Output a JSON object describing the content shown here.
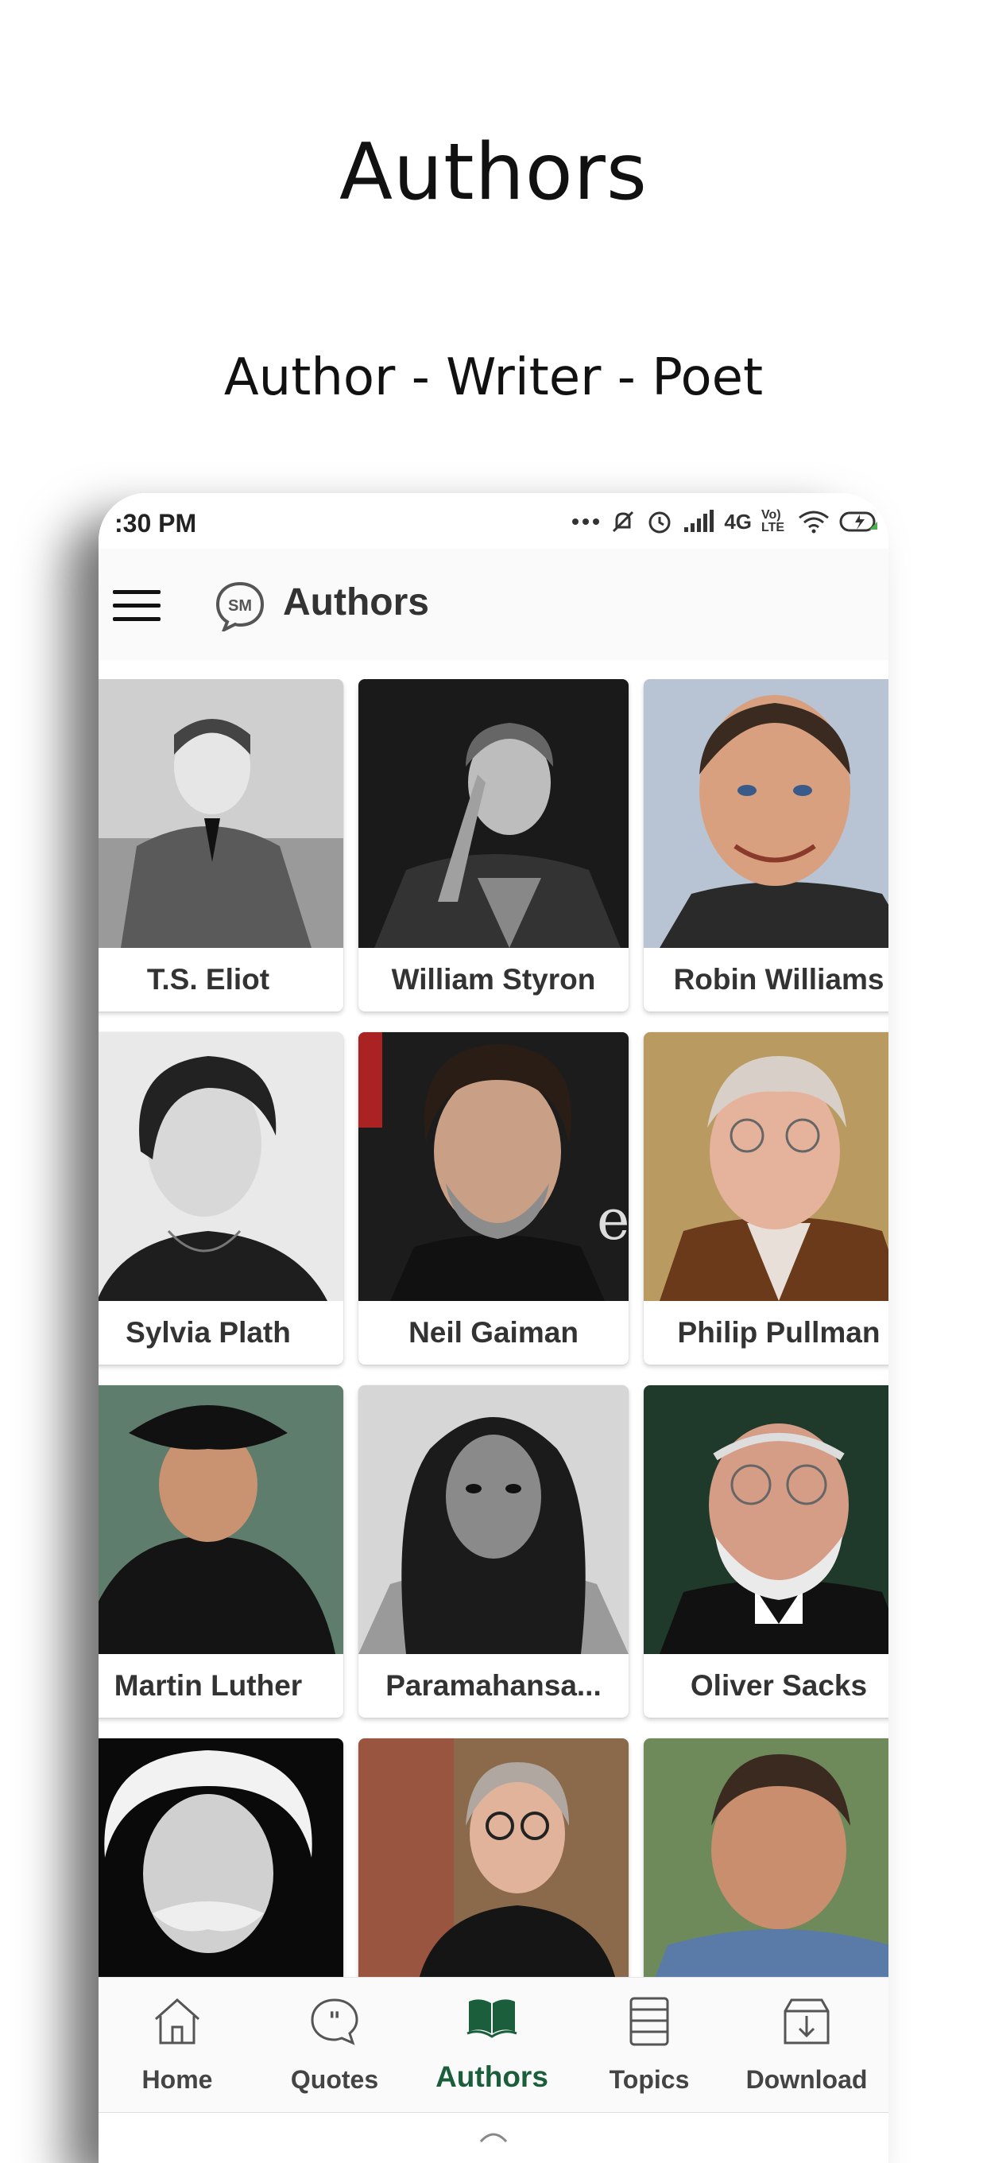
{
  "promo": {
    "title": "Authors",
    "subtitle": "Author - Writer - Poet"
  },
  "status_bar": {
    "time": ":30 PM",
    "network": "4G",
    "volte": "Vo) LTE"
  },
  "app_bar": {
    "title": "Authors",
    "logo_text": "SM",
    "menu_icon": "hamburger-menu-icon"
  },
  "authors": [
    {
      "name": "T.S. Eliot"
    },
    {
      "name": "William Styron"
    },
    {
      "name": "Robin Williams"
    },
    {
      "name": "Sylvia Plath"
    },
    {
      "name": "Neil Gaiman"
    },
    {
      "name": "Philip Pullman"
    },
    {
      "name": "Martin Luther"
    },
    {
      "name": "Paramahansa..."
    },
    {
      "name": "Oliver Sacks"
    },
    {
      "name": ""
    },
    {
      "name": ""
    },
    {
      "name": ""
    }
  ],
  "bottom_nav": [
    {
      "label": "Home",
      "icon": "home-icon"
    },
    {
      "label": "Quotes",
      "icon": "quote-icon"
    },
    {
      "label": "Authors",
      "icon": "book-icon"
    },
    {
      "label": "Topics",
      "icon": "list-icon"
    },
    {
      "label": "Download",
      "icon": "download-icon"
    }
  ],
  "colors": {
    "accent": "#1b5e3b",
    "text": "#333333",
    "background": "#ffffff"
  }
}
